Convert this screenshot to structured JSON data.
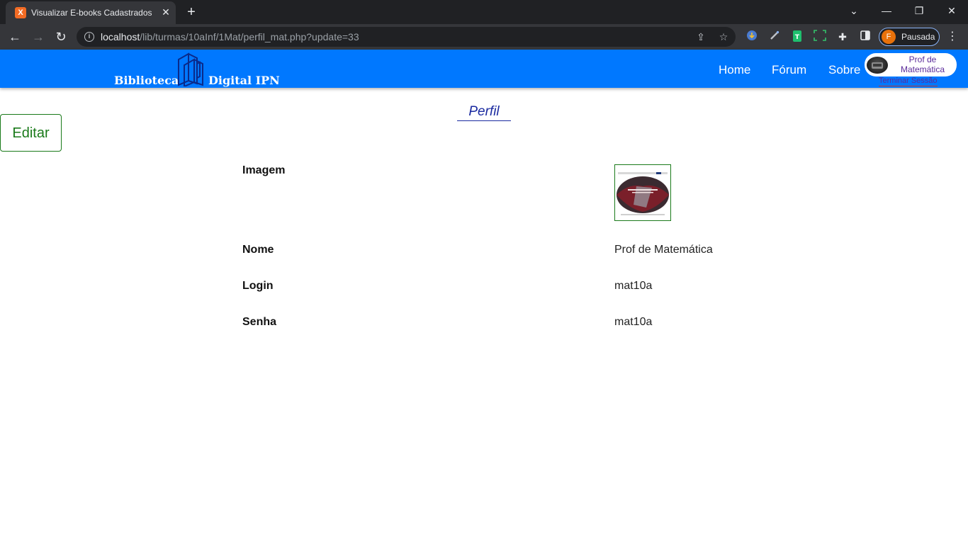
{
  "browser": {
    "tab_title": "Visualizar E-books Cadastrados",
    "favicon": "xampp-icon",
    "url_host": "localhost",
    "url_path": "/lib/turmas/10aInf/1Mat/perfil_mat.php?update=33",
    "profile_initial": "F",
    "profile_status": "Pausada"
  },
  "nav": {
    "brand_left": "Biblioteca",
    "brand_right": "Digital IPN",
    "links": [
      "Home",
      "Fórum",
      "Sobre"
    ],
    "user_name": "Prof de Matemática",
    "logout": "Terminar Sessão",
    "bg_color": "#0078ff"
  },
  "page": {
    "title": "Perfil",
    "edit_button": "Editar"
  },
  "profile": {
    "image_label": "Imagem",
    "name_label": "Nome",
    "name_value": "Prof de Matemática",
    "login_label": "Login",
    "login_value": "mat10a",
    "password_label": "Senha",
    "password_value": "mat10a"
  }
}
